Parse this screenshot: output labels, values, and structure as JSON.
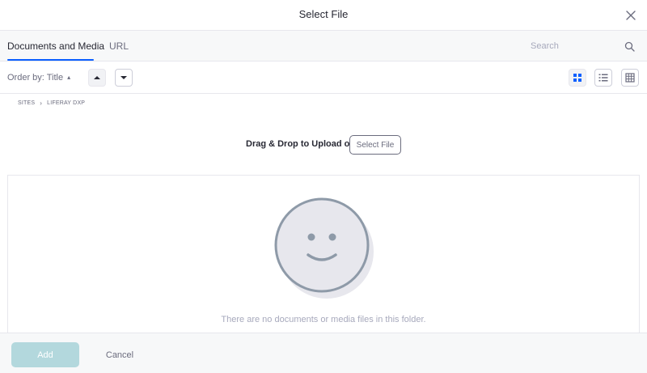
{
  "modal": {
    "title": "Select File"
  },
  "tabs": [
    {
      "label": "Documents and Media",
      "active": true
    },
    {
      "label": "URL",
      "active": false
    }
  ],
  "search": {
    "placeholder": "Search",
    "value": ""
  },
  "toolbar": {
    "order_by_label": "Order by: Title",
    "sort_ascending_icon": "caret-up-icon",
    "sort_descending_icon": "caret-down-icon",
    "views": [
      {
        "name": "cards-view",
        "icon": "grid-icon",
        "active": true
      },
      {
        "name": "list-view",
        "icon": "list-icon",
        "active": false
      },
      {
        "name": "table-view",
        "icon": "table-icon",
        "active": false
      }
    ]
  },
  "breadcrumb": [
    "SITES",
    "LIFERAY DXP"
  ],
  "upload": {
    "text": "Drag & Drop to Upload or",
    "button_label": "Select File"
  },
  "empty_state": {
    "message": "There are no documents or media files in this folder.",
    "icon": "smiley-face-icon"
  },
  "footer": {
    "add_label": "Add",
    "cancel_label": "Cancel"
  },
  "colors": {
    "accent": "#0b5fff",
    "add_disabled": "#b3d8dd",
    "muted_text": "#a7a9bc"
  }
}
